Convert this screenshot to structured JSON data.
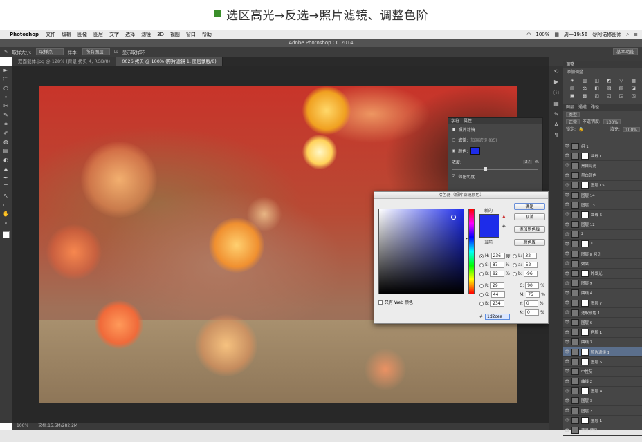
{
  "caption": {
    "text": "选区高光→反选→照片滤镜、调整色阶",
    "accent": "#3a8e2a"
  },
  "menubar": {
    "apple": "",
    "app_name": "Photoshop",
    "items": [
      "文件",
      "编辑",
      "图像",
      "图层",
      "文字",
      "选择",
      "滤镜",
      "3D",
      "视图",
      "窗口",
      "帮助"
    ],
    "battery": "100%",
    "clock": "周一19:56",
    "user": "@阿诺修图师"
  },
  "window_title": "Adobe Photoshop CC 2014",
  "options_bar": {
    "sample_size_label": "取样大小:",
    "sample_size_value": "取样点",
    "sample_label": "样本:",
    "sample_value": "所有图层",
    "show_ring_label": "显示取样环",
    "workspace": "基本功能"
  },
  "doc_tabs": [
    {
      "label": "双面载体.jpg @ 128% (背景 拷贝 4, RGB/8)",
      "active": false
    },
    {
      "label": "0026 拷贝 @ 100% (照片滤镜 1, 图层蒙版/8)",
      "active": true
    }
  ],
  "tools": [
    "►",
    "⬚",
    "○",
    "⌖",
    "✂",
    "✎",
    "⌗",
    "✐",
    "◍",
    "▤",
    "◐",
    "▲",
    "✒",
    "T",
    "↖",
    "▭",
    "✋",
    "⌕"
  ],
  "status": {
    "zoom": "100%",
    "doc": "文档:15.5M/282.2M"
  },
  "adjustments_panel": {
    "title": "调整",
    "subtitle": "添加调整",
    "icons": [
      "☀",
      "▥",
      "◫",
      "◩",
      "▽",
      "▦",
      "▤",
      "⚖",
      "◧",
      "▧",
      "▨",
      "◪",
      "▣",
      "▩",
      "◰",
      "◱",
      "◲",
      "◳"
    ]
  },
  "layers_panel": {
    "tabs": [
      "图层",
      "通道",
      "路径"
    ],
    "kind_label": "类型",
    "blend_mode": "正常",
    "opacity_label": "不透明度:",
    "opacity": "100%",
    "lock_label": "锁定:",
    "fill_label": "填充:",
    "fill": "100%",
    "layers": [
      {
        "name": "组 1",
        "selected": false
      },
      {
        "name": "曲线 1",
        "selected": false
      },
      {
        "name": "黑白高光",
        "selected": false
      },
      {
        "name": "黑白颜色",
        "selected": false
      },
      {
        "name": "图层 15",
        "selected": false
      },
      {
        "name": "图层 14",
        "selected": false
      },
      {
        "name": "图层 13",
        "selected": false
      },
      {
        "name": "曲线 5",
        "selected": false
      },
      {
        "name": "图层 12",
        "selected": false
      },
      {
        "name": "2",
        "selected": false
      },
      {
        "name": "1",
        "selected": false
      },
      {
        "name": "图层 8 拷贝",
        "selected": false
      },
      {
        "name": "效果",
        "selected": false
      },
      {
        "name": "外发光",
        "selected": false
      },
      {
        "name": "图层 9",
        "selected": false
      },
      {
        "name": "曲线 4",
        "selected": false
      },
      {
        "name": "图层 7",
        "selected": false
      },
      {
        "name": "选取颜色 1",
        "selected": false
      },
      {
        "name": "图层 6",
        "selected": false
      },
      {
        "name": "色阶 1",
        "selected": false
      },
      {
        "name": "曲线 3",
        "selected": false
      },
      {
        "name": "照片滤镜 1",
        "selected": true
      },
      {
        "name": "图层 5",
        "selected": false
      },
      {
        "name": "中性灰",
        "selected": false
      },
      {
        "name": "曲线 2",
        "selected": false
      },
      {
        "name": "图层 4",
        "selected": false
      },
      {
        "name": "图层 3",
        "selected": false
      },
      {
        "name": "图层 2",
        "selected": false
      },
      {
        "name": "图层 1",
        "selected": false
      },
      {
        "name": "背景 拷贝",
        "selected": false
      }
    ]
  },
  "properties_panel": {
    "tabs": [
      "字符",
      "属性"
    ],
    "title": "照片滤镜",
    "filter_label": "滤镜:",
    "filter_value": "加温滤镜 (85)",
    "color_label": "颜色:",
    "color": "#1d2cea",
    "density_label": "浓度:",
    "density": "37",
    "density_unit": "%",
    "density_value": 37,
    "preserve_label": "保留明度"
  },
  "color_picker": {
    "title": "拾色器（照片滤镜颜色）",
    "new_label": "新的",
    "current_label": "当前",
    "ok": "确定",
    "cancel": "取消",
    "add_swatch": "添加到色板",
    "libraries": "颜色库",
    "web_only": "只有 Web 颜色",
    "hsb": [
      {
        "k": "H:",
        "v": "236",
        "u": "度",
        "on": true
      },
      {
        "k": "S:",
        "v": "87",
        "u": "%",
        "on": false
      },
      {
        "k": "B:",
        "v": "92",
        "u": "%",
        "on": false
      }
    ],
    "rgb": [
      {
        "k": "R:",
        "v": "29",
        "on": false
      },
      {
        "k": "G:",
        "v": "44",
        "on": false
      },
      {
        "k": "B:",
        "v": "234",
        "on": false
      }
    ],
    "lab": [
      {
        "k": "L:",
        "v": "32",
        "on": false
      },
      {
        "k": "a:",
        "v": "52",
        "on": false
      },
      {
        "k": "b:",
        "v": "-96",
        "on": false
      }
    ],
    "cmyk": [
      {
        "k": "C:",
        "v": "90",
        "u": "%"
      },
      {
        "k": "M:",
        "v": "75",
        "u": "%"
      },
      {
        "k": "Y:",
        "v": "0",
        "u": "%"
      },
      {
        "k": "K:",
        "v": "0",
        "u": "%"
      }
    ],
    "hex_label": "#",
    "hex": "1d2cea"
  }
}
